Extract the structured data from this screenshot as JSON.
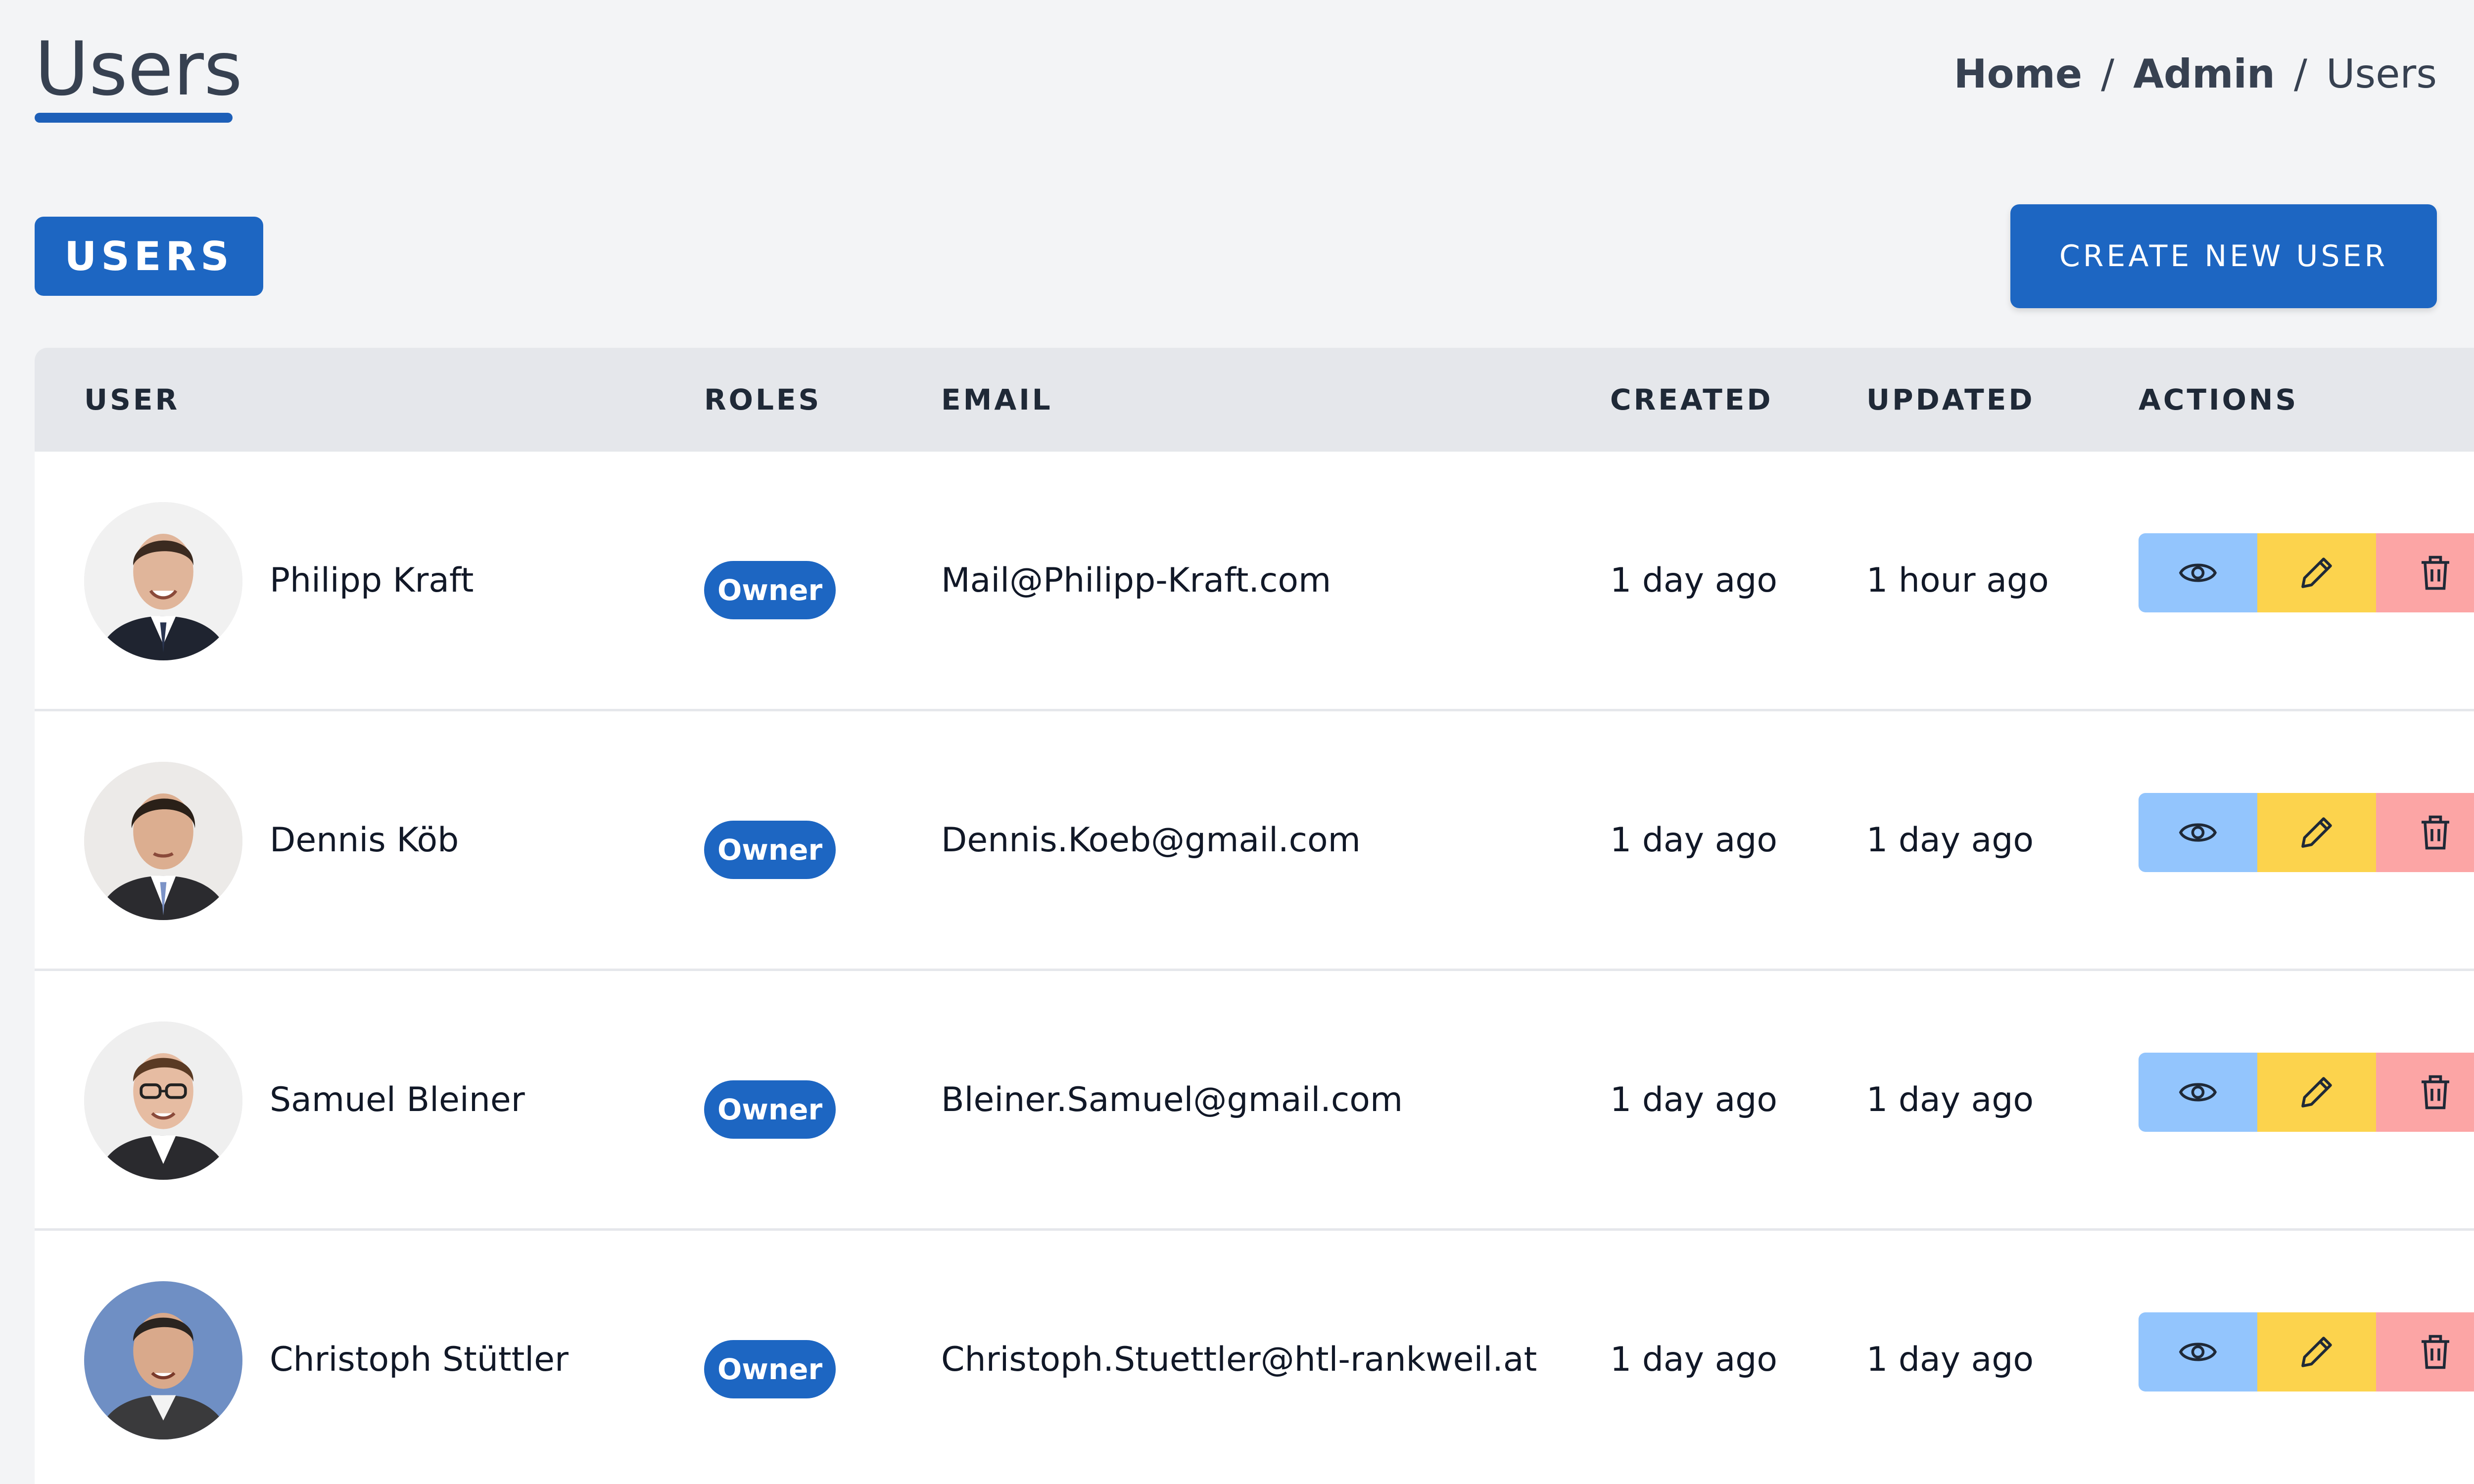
{
  "header": {
    "title": "Users",
    "breadcrumb": [
      "Home",
      "Admin",
      "Users"
    ],
    "breadcrumb_separator": "/"
  },
  "toolbar": {
    "section_label": "USERS",
    "create_label": "CREATE NEW USER"
  },
  "table": {
    "columns": [
      "USER",
      "ROLES",
      "EMAIL",
      "CREATED",
      "UPDATED",
      "ACTIONS"
    ],
    "rows": [
      {
        "name": "Philipp Kraft",
        "role": "Owner",
        "email": "Mail@Philipp-Kraft.com",
        "created": "1 day ago",
        "updated": "1 hour ago"
      },
      {
        "name": "Dennis Köb",
        "role": "Owner",
        "email": "Dennis.Koeb@gmail.com",
        "created": "1 day ago",
        "updated": "1 day ago"
      },
      {
        "name": "Samuel Bleiner",
        "role": "Owner",
        "email": "Bleiner.Samuel@gmail.com",
        "created": "1 day ago",
        "updated": "1 day ago"
      },
      {
        "name": "Christoph Stüttler",
        "role": "Owner",
        "email": "Christoph.Stuettler@htl-rankweil.at",
        "created": "1 day ago",
        "updated": "1 day ago"
      }
    ]
  },
  "icons": {
    "view": "eye-icon",
    "edit": "pencil-icon",
    "delete": "trash-icon"
  },
  "colors": {
    "primary": "#1d66c2",
    "view_button": "#93c5fd",
    "edit_button": "#fcd34d",
    "delete_button": "#fca5a5",
    "header_bg": "#e5e7eb",
    "page_bg": "#f3f4f6"
  }
}
